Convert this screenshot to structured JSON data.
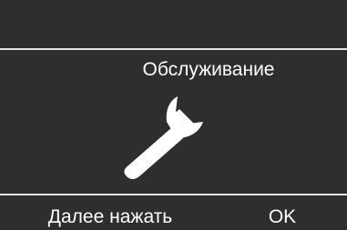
{
  "screen": {
    "title": "Обслуживание",
    "icon": "wrench-icon"
  },
  "softkeys": {
    "left_label": "Далее нажать",
    "right_label": "OK"
  },
  "colors": {
    "background": "#2e2e2e",
    "foreground": "#ffffff",
    "divider": "#e6e6e6"
  }
}
